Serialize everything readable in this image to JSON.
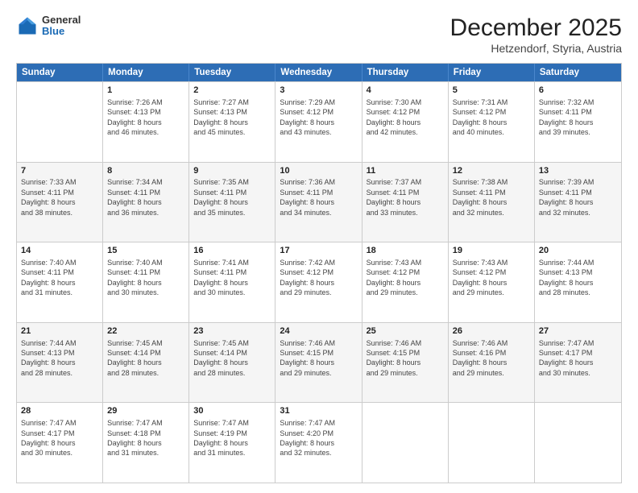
{
  "logo": {
    "general": "General",
    "blue": "Blue"
  },
  "header": {
    "month": "December 2025",
    "location": "Hetzendorf, Styria, Austria"
  },
  "days": [
    "Sunday",
    "Monday",
    "Tuesday",
    "Wednesday",
    "Thursday",
    "Friday",
    "Saturday"
  ],
  "rows": [
    [
      {
        "num": "",
        "lines": []
      },
      {
        "num": "1",
        "lines": [
          "Sunrise: 7:26 AM",
          "Sunset: 4:13 PM",
          "Daylight: 8 hours",
          "and 46 minutes."
        ]
      },
      {
        "num": "2",
        "lines": [
          "Sunrise: 7:27 AM",
          "Sunset: 4:13 PM",
          "Daylight: 8 hours",
          "and 45 minutes."
        ]
      },
      {
        "num": "3",
        "lines": [
          "Sunrise: 7:29 AM",
          "Sunset: 4:12 PM",
          "Daylight: 8 hours",
          "and 43 minutes."
        ]
      },
      {
        "num": "4",
        "lines": [
          "Sunrise: 7:30 AM",
          "Sunset: 4:12 PM",
          "Daylight: 8 hours",
          "and 42 minutes."
        ]
      },
      {
        "num": "5",
        "lines": [
          "Sunrise: 7:31 AM",
          "Sunset: 4:12 PM",
          "Daylight: 8 hours",
          "and 40 minutes."
        ]
      },
      {
        "num": "6",
        "lines": [
          "Sunrise: 7:32 AM",
          "Sunset: 4:11 PM",
          "Daylight: 8 hours",
          "and 39 minutes."
        ]
      }
    ],
    [
      {
        "num": "7",
        "lines": [
          "Sunrise: 7:33 AM",
          "Sunset: 4:11 PM",
          "Daylight: 8 hours",
          "and 38 minutes."
        ]
      },
      {
        "num": "8",
        "lines": [
          "Sunrise: 7:34 AM",
          "Sunset: 4:11 PM",
          "Daylight: 8 hours",
          "and 36 minutes."
        ]
      },
      {
        "num": "9",
        "lines": [
          "Sunrise: 7:35 AM",
          "Sunset: 4:11 PM",
          "Daylight: 8 hours",
          "and 35 minutes."
        ]
      },
      {
        "num": "10",
        "lines": [
          "Sunrise: 7:36 AM",
          "Sunset: 4:11 PM",
          "Daylight: 8 hours",
          "and 34 minutes."
        ]
      },
      {
        "num": "11",
        "lines": [
          "Sunrise: 7:37 AM",
          "Sunset: 4:11 PM",
          "Daylight: 8 hours",
          "and 33 minutes."
        ]
      },
      {
        "num": "12",
        "lines": [
          "Sunrise: 7:38 AM",
          "Sunset: 4:11 PM",
          "Daylight: 8 hours",
          "and 32 minutes."
        ]
      },
      {
        "num": "13",
        "lines": [
          "Sunrise: 7:39 AM",
          "Sunset: 4:11 PM",
          "Daylight: 8 hours",
          "and 32 minutes."
        ]
      }
    ],
    [
      {
        "num": "14",
        "lines": [
          "Sunrise: 7:40 AM",
          "Sunset: 4:11 PM",
          "Daylight: 8 hours",
          "and 31 minutes."
        ]
      },
      {
        "num": "15",
        "lines": [
          "Sunrise: 7:40 AM",
          "Sunset: 4:11 PM",
          "Daylight: 8 hours",
          "and 30 minutes."
        ]
      },
      {
        "num": "16",
        "lines": [
          "Sunrise: 7:41 AM",
          "Sunset: 4:11 PM",
          "Daylight: 8 hours",
          "and 30 minutes."
        ]
      },
      {
        "num": "17",
        "lines": [
          "Sunrise: 7:42 AM",
          "Sunset: 4:12 PM",
          "Daylight: 8 hours",
          "and 29 minutes."
        ]
      },
      {
        "num": "18",
        "lines": [
          "Sunrise: 7:43 AM",
          "Sunset: 4:12 PM",
          "Daylight: 8 hours",
          "and 29 minutes."
        ]
      },
      {
        "num": "19",
        "lines": [
          "Sunrise: 7:43 AM",
          "Sunset: 4:12 PM",
          "Daylight: 8 hours",
          "and 29 minutes."
        ]
      },
      {
        "num": "20",
        "lines": [
          "Sunrise: 7:44 AM",
          "Sunset: 4:13 PM",
          "Daylight: 8 hours",
          "and 28 minutes."
        ]
      }
    ],
    [
      {
        "num": "21",
        "lines": [
          "Sunrise: 7:44 AM",
          "Sunset: 4:13 PM",
          "Daylight: 8 hours",
          "and 28 minutes."
        ]
      },
      {
        "num": "22",
        "lines": [
          "Sunrise: 7:45 AM",
          "Sunset: 4:14 PM",
          "Daylight: 8 hours",
          "and 28 minutes."
        ]
      },
      {
        "num": "23",
        "lines": [
          "Sunrise: 7:45 AM",
          "Sunset: 4:14 PM",
          "Daylight: 8 hours",
          "and 28 minutes."
        ]
      },
      {
        "num": "24",
        "lines": [
          "Sunrise: 7:46 AM",
          "Sunset: 4:15 PM",
          "Daylight: 8 hours",
          "and 29 minutes."
        ]
      },
      {
        "num": "25",
        "lines": [
          "Sunrise: 7:46 AM",
          "Sunset: 4:15 PM",
          "Daylight: 8 hours",
          "and 29 minutes."
        ]
      },
      {
        "num": "26",
        "lines": [
          "Sunrise: 7:46 AM",
          "Sunset: 4:16 PM",
          "Daylight: 8 hours",
          "and 29 minutes."
        ]
      },
      {
        "num": "27",
        "lines": [
          "Sunrise: 7:47 AM",
          "Sunset: 4:17 PM",
          "Daylight: 8 hours",
          "and 30 minutes."
        ]
      }
    ],
    [
      {
        "num": "28",
        "lines": [
          "Sunrise: 7:47 AM",
          "Sunset: 4:17 PM",
          "Daylight: 8 hours",
          "and 30 minutes."
        ]
      },
      {
        "num": "29",
        "lines": [
          "Sunrise: 7:47 AM",
          "Sunset: 4:18 PM",
          "Daylight: 8 hours",
          "and 31 minutes."
        ]
      },
      {
        "num": "30",
        "lines": [
          "Sunrise: 7:47 AM",
          "Sunset: 4:19 PM",
          "Daylight: 8 hours",
          "and 31 minutes."
        ]
      },
      {
        "num": "31",
        "lines": [
          "Sunrise: 7:47 AM",
          "Sunset: 4:20 PM",
          "Daylight: 8 hours",
          "and 32 minutes."
        ]
      },
      {
        "num": "",
        "lines": []
      },
      {
        "num": "",
        "lines": []
      },
      {
        "num": "",
        "lines": []
      }
    ]
  ]
}
